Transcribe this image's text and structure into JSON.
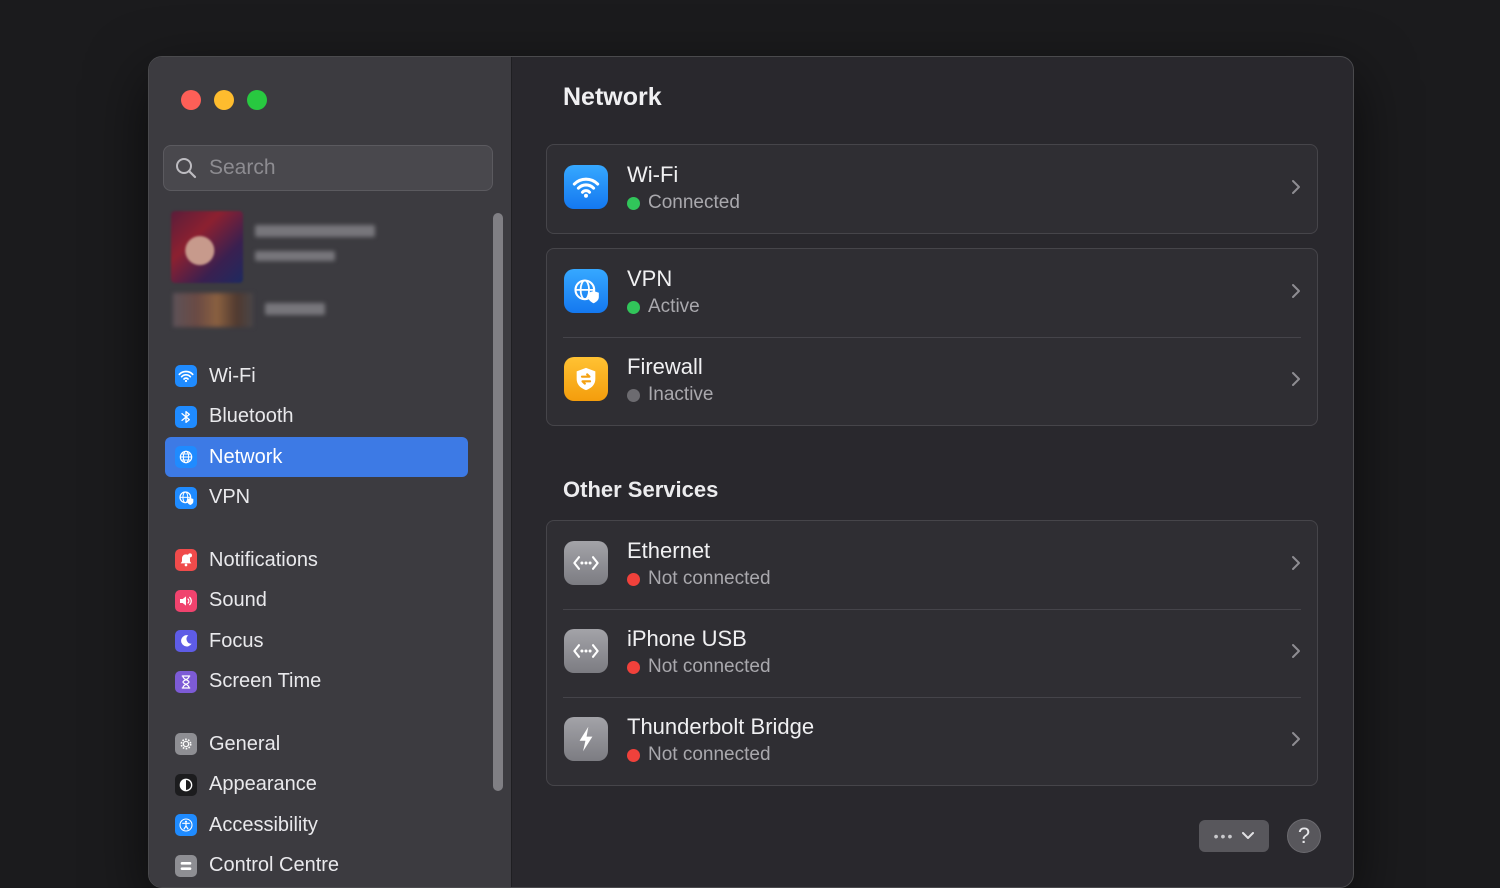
{
  "window": {
    "colors": {
      "accent": "#3d7ae5"
    }
  },
  "sidebar": {
    "search": {
      "placeholder": "Search"
    },
    "groups": [
      [
        {
          "label": "Wi-Fi",
          "icon": "wifi-icon",
          "color": "#1f8bff"
        },
        {
          "label": "Bluetooth",
          "icon": "bluetooth-icon",
          "color": "#1f8bff"
        },
        {
          "label": "Network",
          "icon": "globe-icon",
          "color": "#1f8bff",
          "active": true
        },
        {
          "label": "VPN",
          "icon": "globe-shield-icon",
          "color": "#1f8bff"
        }
      ],
      [
        {
          "label": "Notifications",
          "icon": "bell-icon",
          "color": "#f04b4b"
        },
        {
          "label": "Sound",
          "icon": "speaker-icon",
          "color": "#f0436e"
        },
        {
          "label": "Focus",
          "icon": "moon-icon",
          "color": "#5e5ce6"
        },
        {
          "label": "Screen Time",
          "icon": "hourglass-icon",
          "color": "#7d5bd6"
        }
      ],
      [
        {
          "label": "General",
          "icon": "gear-icon",
          "color": "#8e8e93"
        },
        {
          "label": "Appearance",
          "icon": "appearance-icon",
          "color": "#1c1c1e"
        },
        {
          "label": "Accessibility",
          "icon": "accessibility-icon",
          "color": "#1f8bff"
        },
        {
          "label": "Control Centre",
          "icon": "control-centre-icon",
          "color": "#8e8e93"
        }
      ]
    ]
  },
  "main": {
    "title": "Network",
    "primary_group_1": [
      {
        "title": "Wi-Fi",
        "status": "Connected",
        "status_color": "green",
        "icon": "wifi-icon"
      }
    ],
    "primary_group_2": [
      {
        "title": "VPN",
        "status": "Active",
        "status_color": "green",
        "icon": "globe-shield-icon"
      },
      {
        "title": "Firewall",
        "status": "Inactive",
        "status_color": "gray",
        "icon": "firewall-icon"
      }
    ],
    "other_services_title": "Other Services",
    "other_services": [
      {
        "title": "Ethernet",
        "status": "Not connected",
        "status_color": "red",
        "icon": "ethernet-icon"
      },
      {
        "title": "iPhone USB",
        "status": "Not connected",
        "status_color": "red",
        "icon": "ethernet-icon"
      },
      {
        "title": "Thunderbolt Bridge",
        "status": "Not connected",
        "status_color": "red",
        "icon": "thunderbolt-icon"
      }
    ],
    "help_label": "?"
  }
}
